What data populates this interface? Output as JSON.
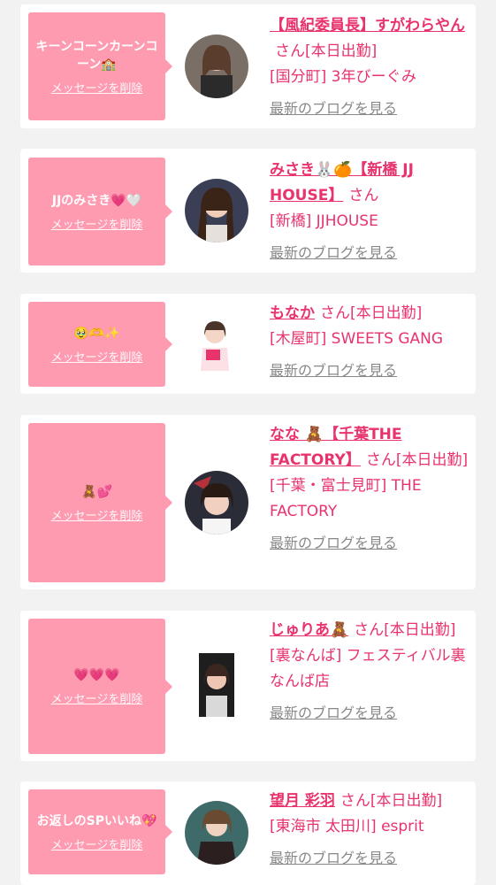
{
  "delete_label": "メッセージを削除",
  "blog_label": "最新のブログを見る",
  "san": "さん",
  "colors": {
    "accent": "#e8336d",
    "bubble": "#ff9bb1",
    "link_gray": "#888888"
  },
  "cards": [
    {
      "message": "キーンコーンカーンコーン🏫",
      "name": "【風紀委員長】すがわらやん",
      "status": "[本日出勤]",
      "shop": "[国分町] 3年びーぐみ"
    },
    {
      "message": "JJのみさき💗🤍",
      "name": "みさき🐰🍊【新橋 JJ HOUSE】",
      "status": "",
      "shop": "[新橋] JJHOUSE"
    },
    {
      "message": "🥹🫶✨",
      "name": "もなか",
      "status": "[本日出勤]",
      "shop": "[木屋町] SWEETS GANG"
    },
    {
      "message": "🧸💕",
      "name": "なな 🧸【千葉THE FACTORY】",
      "status": "[本日出勤]",
      "shop": "[千葉・富士見町] THE FACTORY"
    },
    {
      "message": "💗💗💗",
      "name": "じゅりあ🧸",
      "status": "[本日出勤]",
      "shop": "[裏なんば] フェスティバル裏なんば店"
    },
    {
      "message": "お返しのSPいいね💖",
      "name": "望月 彩羽",
      "status": "[本日出勤]",
      "shop": "[東海市 太田川] esprit"
    }
  ]
}
